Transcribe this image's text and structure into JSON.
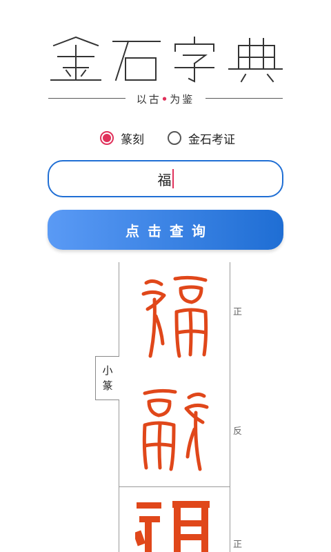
{
  "app": {
    "logo_text": "金石字典",
    "tagline_left": "以古",
    "tagline_dot": "•",
    "tagline_right": "为鉴"
  },
  "search_mode": {
    "options": [
      {
        "label": "篆刻",
        "checked": true
      },
      {
        "label": "金石考证",
        "checked": false
      }
    ]
  },
  "search": {
    "value": "福"
  },
  "query_button": {
    "label": "点击查询"
  },
  "results": {
    "style_label_line1": "小",
    "style_label_line2": "篆",
    "entries": [
      {
        "orientation": "正"
      },
      {
        "orientation": "反"
      },
      {
        "orientation": "正"
      }
    ]
  },
  "colors": {
    "accent_pink": "#e0305a",
    "primary_blue": "#1f6ed4",
    "seal_red": "#e0471a"
  }
}
